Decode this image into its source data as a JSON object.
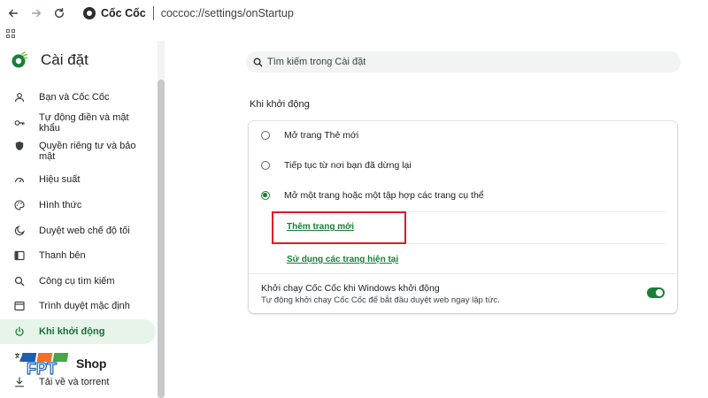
{
  "toolbar": {
    "brand_name": "Cốc Cốc",
    "url": "coccoc://settings/onStartup",
    "icons": [
      "back-icon",
      "forward-icon",
      "reload-icon",
      "coccoc-logo",
      "apps-icon"
    ]
  },
  "settings": {
    "title": "Cài đặt",
    "search_placeholder": "Tìm kiếm trong Cài đặt"
  },
  "sidebar": {
    "items": [
      {
        "label": "Bạn và Cốc Cốc",
        "icon": "person-icon"
      },
      {
        "label": "Tự động điền và mật khẩu",
        "icon": "key-icon"
      },
      {
        "label": "Quyền riêng tư và bảo mật",
        "icon": "shield-icon"
      },
      {
        "label": "Hiệu suất",
        "icon": "speedometer-icon"
      },
      {
        "label": "Hình thức",
        "icon": "palette-icon"
      },
      {
        "label": "Duyệt web chế độ tối",
        "icon": "moon-icon"
      },
      {
        "label": "Thanh bên",
        "icon": "sidebar-panel-icon"
      },
      {
        "label": "Công cụ tìm kiếm",
        "icon": "search-icon"
      },
      {
        "label": "Trình duyệt mặc định",
        "icon": "browser-window-icon"
      },
      {
        "label": "Khi khởi động",
        "icon": "power-icon",
        "active": true
      },
      {
        "label": "",
        "icon": "translate-icon"
      },
      {
        "label": "Tải về và torrent",
        "icon": "download-icon"
      }
    ]
  },
  "main": {
    "section_title": "Khi khởi động",
    "options": [
      {
        "label": "Mở trang Thẻ mới",
        "checked": false
      },
      {
        "label": "Tiếp tục từ nơi bạn đã dừng lại",
        "checked": false
      },
      {
        "label": "Mở một trang hoặc một tập hợp các trang cụ thể",
        "checked": true
      }
    ],
    "add_page_link": "Thêm trang mới",
    "use_current_link": "Sử dụng các trang hiện tại",
    "startup_launch_title": "Khởi chạy Cốc Cốc khi Windows khởi động",
    "startup_launch_desc": "Tự động khởi chạy Cốc Cốc để bắt đầu duyệt web ngay lập tức.",
    "startup_launch_enabled": true
  },
  "watermark": {
    "logo_text": "FPT",
    "shop_text": "Shop"
  },
  "colors": {
    "accent": "#188038",
    "active_bg": "#e6f4ea",
    "highlight": "#e01b24"
  }
}
